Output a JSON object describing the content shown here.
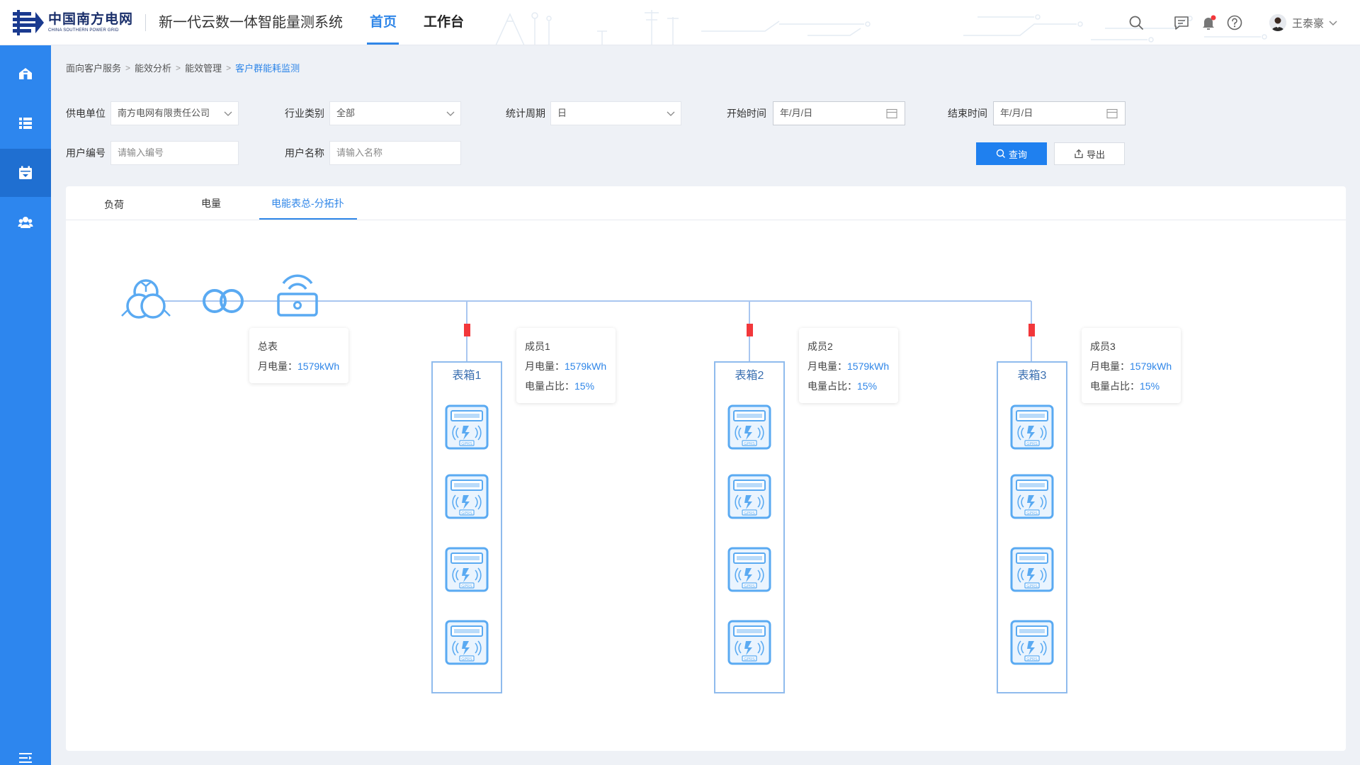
{
  "header": {
    "logo_cn": "中国南方电网",
    "logo_en": "CHINA SOUTHERN POWER GRID",
    "system_title": "新一代云数一体智能量测系统",
    "nav": [
      {
        "label": "首页",
        "active": true
      },
      {
        "label": "工作台",
        "active": false
      }
    ],
    "icons": [
      "search-icon",
      "message-icon",
      "bell-icon",
      "help-icon"
    ],
    "notification_dot": true,
    "user_name": "王泰豪"
  },
  "sidebar": {
    "items": [
      {
        "icon": "home-icon",
        "active": false
      },
      {
        "icon": "list-icon",
        "active": false
      },
      {
        "icon": "calendar-icon",
        "active": true
      },
      {
        "icon": "users-icon",
        "active": false
      }
    ],
    "bottom_icon": "menu-collapse-icon"
  },
  "breadcrumb": [
    "面向客户服务",
    "能效分析",
    "能效管理",
    "客户群能耗监测"
  ],
  "filters": {
    "supply_unit": {
      "label": "供电单位",
      "value": "南方电网有限责任公司"
    },
    "industry": {
      "label": "行业类别",
      "value": "全部"
    },
    "period": {
      "label": "统计周期",
      "value": "日"
    },
    "start_time": {
      "label": "开始时间",
      "placeholder": "年/月/日"
    },
    "end_time": {
      "label": "结束时间",
      "placeholder": "年/月/日"
    },
    "user_no": {
      "label": "用户编号",
      "placeholder": "请输入编号"
    },
    "user_name": {
      "label": "用户名称",
      "placeholder": "请输入名称"
    },
    "query_button": "查询",
    "export_button": "导出"
  },
  "tabs": [
    {
      "label": "负荷",
      "active": false
    },
    {
      "label": "电量",
      "active": false
    },
    {
      "label": "电能表总-分拓扑",
      "active": true
    }
  ],
  "topology": {
    "main_meter": {
      "title": "总表",
      "month_label": "月电量：",
      "month_value": "1579kWh"
    },
    "members": [
      {
        "title": "成员1",
        "month_label": "月电量：",
        "month_value": "1579kWh",
        "ratio_label": "电量占比：",
        "ratio_value": "15%",
        "box_title": "表箱1",
        "meters": 4
      },
      {
        "title": "成员2",
        "month_label": "月电量：",
        "month_value": "1579kWh",
        "ratio_label": "电量占比：",
        "ratio_value": "15%",
        "box_title": "表箱2",
        "meters": 4
      },
      {
        "title": "成员3",
        "month_label": "月电量：",
        "month_value": "1579kWh",
        "ratio_label": "电量占比：",
        "ratio_value": "15%",
        "box_title": "表箱3",
        "meters": 4
      }
    ],
    "meter_label": "GPRS",
    "colors": {
      "line": "#a9c6f0",
      "icon": "#5aaaf2",
      "switch": "#f2373b",
      "accent": "#2f86e8"
    }
  }
}
